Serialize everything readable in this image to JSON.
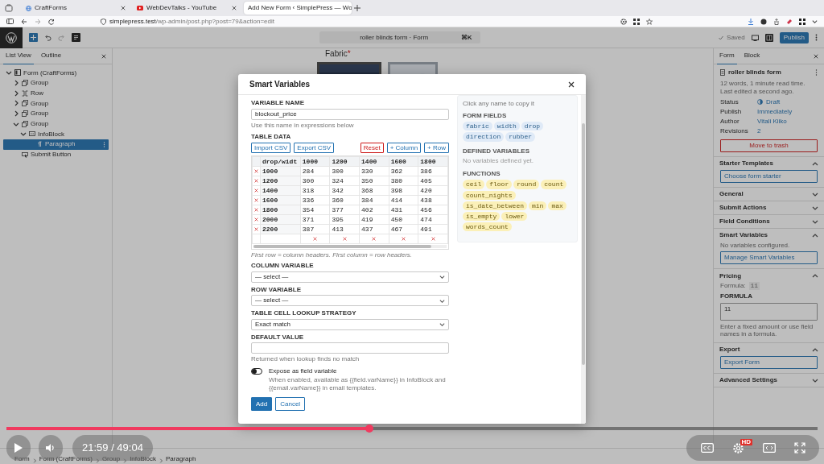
{
  "browser": {
    "tabs": [
      {
        "title": "CraftForms",
        "selected": false
      },
      {
        "title": "WebDevTalks - YouTube",
        "selected": false
      },
      {
        "title": "Add New Form ‹ SimplePress — Wo",
        "selected": true
      }
    ],
    "url_host": "simplepress.test",
    "url_path": "/wp-admin/post.php?post=79&action=edit"
  },
  "editor_header": {
    "command_title": "roller blinds form · Form",
    "shortcut": "⌘K",
    "saved": "Saved",
    "publish": "Publish"
  },
  "list_view": {
    "tabs": [
      {
        "label": "List View",
        "selected": true
      },
      {
        "label": "Outline",
        "selected": false
      }
    ],
    "tree": [
      {
        "label": "Form (CraftForms)",
        "kind": "form",
        "expandable": true,
        "expanded": true,
        "selected": false,
        "children": [
          {
            "label": "Group",
            "kind": "group",
            "expandable": true,
            "expanded": false,
            "selected": false
          },
          {
            "label": "Row",
            "kind": "row",
            "expandable": true,
            "expanded": false,
            "selected": false
          },
          {
            "label": "Group",
            "kind": "group",
            "expandable": true,
            "expanded": false,
            "selected": false
          },
          {
            "label": "Group",
            "kind": "group",
            "expandable": true,
            "expanded": false,
            "selected": false
          },
          {
            "label": "Group",
            "kind": "group",
            "expandable": true,
            "expanded": true,
            "selected": false,
            "children": [
              {
                "label": "InfoBlock",
                "kind": "infoblock",
                "expandable": true,
                "expanded": true,
                "selected": false,
                "children": [
                  {
                    "label": "Paragraph",
                    "kind": "paragraph",
                    "expandable": false,
                    "selected": true
                  }
                ]
              }
            ]
          },
          {
            "label": "Submit Button",
            "kind": "button",
            "expandable": false,
            "selected": false
          }
        ]
      }
    ]
  },
  "canvas": {
    "field_label": "Fabric",
    "required_mark": "*"
  },
  "modal": {
    "title": "Smart Variables",
    "variable_name": {
      "label": "VARIABLE NAME",
      "value": "blockout_price",
      "help": "Use this name in expressions below"
    },
    "table_data": {
      "label": "TABLE DATA",
      "buttons": [
        {
          "label": "Import CSV",
          "kind": "primary"
        },
        {
          "label": "Export CSV",
          "kind": "primary"
        },
        {
          "label": "Reset",
          "kind": "danger"
        },
        {
          "label": "+ Column",
          "kind": "primary"
        },
        {
          "label": "+ Row",
          "kind": "primary"
        }
      ],
      "header": [
        "drop/widt",
        "1000",
        "1200",
        "1400",
        "1600",
        "1800"
      ],
      "rows": [
        [
          "1000",
          "284",
          "300",
          "330",
          "362",
          "386"
        ],
        [
          "1200",
          "300",
          "324",
          "350",
          "380",
          "405"
        ],
        [
          "1400",
          "318",
          "342",
          "368",
          "398",
          "420"
        ],
        [
          "1600",
          "336",
          "360",
          "384",
          "414",
          "438"
        ],
        [
          "1800",
          "354",
          "377",
          "402",
          "431",
          "456"
        ],
        [
          "2000",
          "371",
          "395",
          "419",
          "450",
          "474"
        ],
        [
          "2200",
          "387",
          "413",
          "437",
          "467",
          "491"
        ]
      ],
      "help": "First row = column headers. First column = row headers."
    },
    "selects": [
      {
        "label": "COLUMN VARIABLE",
        "value": "— select —"
      },
      {
        "label": "ROW VARIABLE",
        "value": "— select —"
      },
      {
        "label": "TABLE CELL LOOKUP STRATEGY",
        "value": "Exact match"
      }
    ],
    "default_value": {
      "label": "DEFAULT VALUE",
      "help": "Returned when lookup finds no match"
    },
    "expose": {
      "label": "Expose as field variable",
      "on": false,
      "help": "When enabled, available as {{field.varName}} in InfoBlock and {{email.varName}} in email templates."
    },
    "actions": [
      {
        "label": "Add",
        "kind": "primary"
      },
      {
        "label": "Cancel",
        "kind": "secondary"
      }
    ],
    "reference": {
      "hint": "Click any name to copy it",
      "form_fields_label": "FORM FIELDS",
      "form_fields": [
        "fabric",
        "width",
        "drop",
        "direction",
        "rubber"
      ],
      "defined_label": "DEFINED VARIABLES",
      "defined_empty": "No variables defined yet.",
      "functions_label": "FUNCTIONS",
      "functions": [
        "ceil",
        "floor",
        "round",
        "count",
        "count_nights",
        "is_date_between",
        "min",
        "max",
        "is_empty",
        "lower",
        "words_count"
      ]
    }
  },
  "settings": {
    "tabs": [
      {
        "label": "Form",
        "selected": true
      },
      {
        "label": "Block",
        "selected": false
      }
    ],
    "document": {
      "title": "roller blinds form",
      "stats": "12 words, 1 minute read time.",
      "edited": "Last edited a second ago.",
      "meta": [
        {
          "label": "Status",
          "value": "Draft",
          "kind": "status"
        },
        {
          "label": "Publish",
          "value": "Immediately",
          "kind": "link"
        },
        {
          "label": "Author",
          "value": "Vitali Kiiko",
          "kind": "link"
        },
        {
          "label": "Revisions",
          "value": "2",
          "kind": "link"
        }
      ],
      "trash": "Move to trash"
    },
    "sections": [
      {
        "title": "Starter Templates",
        "expanded": true,
        "content": [
          {
            "kind": "button",
            "label": "Choose form starter"
          }
        ]
      },
      {
        "title": "General",
        "expanded": false
      },
      {
        "title": "Submit Actions",
        "expanded": false
      },
      {
        "title": "Field Conditions",
        "expanded": false
      },
      {
        "title": "Smart Variables",
        "expanded": true,
        "content": [
          {
            "kind": "note",
            "text": "No variables configured."
          },
          {
            "kind": "button",
            "label": "Manage Smart Variables"
          }
        ]
      },
      {
        "title": "Pricing",
        "expanded": true,
        "content": [
          {
            "kind": "summary",
            "label": "Formula:",
            "value": "11"
          },
          {
            "kind": "textarea",
            "label": "FORMULA",
            "value": "11",
            "help": "Enter a fixed amount or use field names in a formula."
          }
        ]
      },
      {
        "title": "Export",
        "expanded": true,
        "content": [
          {
            "kind": "button",
            "label": "Export Form"
          }
        ]
      },
      {
        "title": "Advanced Settings",
        "expanded": false
      }
    ]
  },
  "breadcrumb": [
    "Form",
    "Form (CraftForms)",
    "Group",
    "InfoBlock",
    "Paragraph"
  ],
  "video": {
    "playing": false,
    "progress": {
      "level": 0.447
    },
    "time": "21:59 / 49:04",
    "hd_badge": "HD"
  }
}
